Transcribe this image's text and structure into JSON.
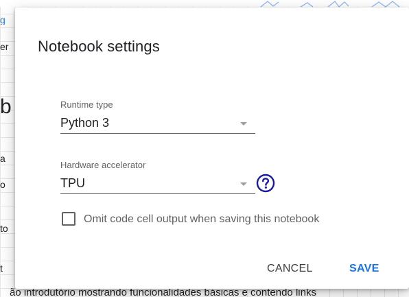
{
  "background": {
    "left_fragments": [
      {
        "text": "g",
        "link": true
      },
      {
        "text": "er",
        "link": false
      },
      {
        "text": "b",
        "link": false,
        "big": true
      },
      {
        "text": "a",
        "link": false
      },
      {
        "text": "o",
        "link": false
      },
      {
        "text": "to",
        "link": false
      },
      {
        "text": "t",
        "link": false
      }
    ],
    "bottom_text": "ão introdutório mostrando funcionalidades básicas e contendo links"
  },
  "dialog": {
    "title": "Notebook settings",
    "runtime": {
      "label": "Runtime type",
      "value": "Python 3"
    },
    "accelerator": {
      "label": "Hardware accelerator",
      "value": "TPU",
      "help_icon": "help-circle-icon"
    },
    "omit_output": {
      "label": "Omit code cell output when saving this notebook",
      "checked": false
    },
    "buttons": {
      "cancel": "CANCEL",
      "save": "SAVE"
    }
  },
  "colors": {
    "accent": "#1a73e8",
    "help_icon": "#1a1aa6",
    "text_primary": "#202124",
    "text_secondary": "#5f6368"
  }
}
